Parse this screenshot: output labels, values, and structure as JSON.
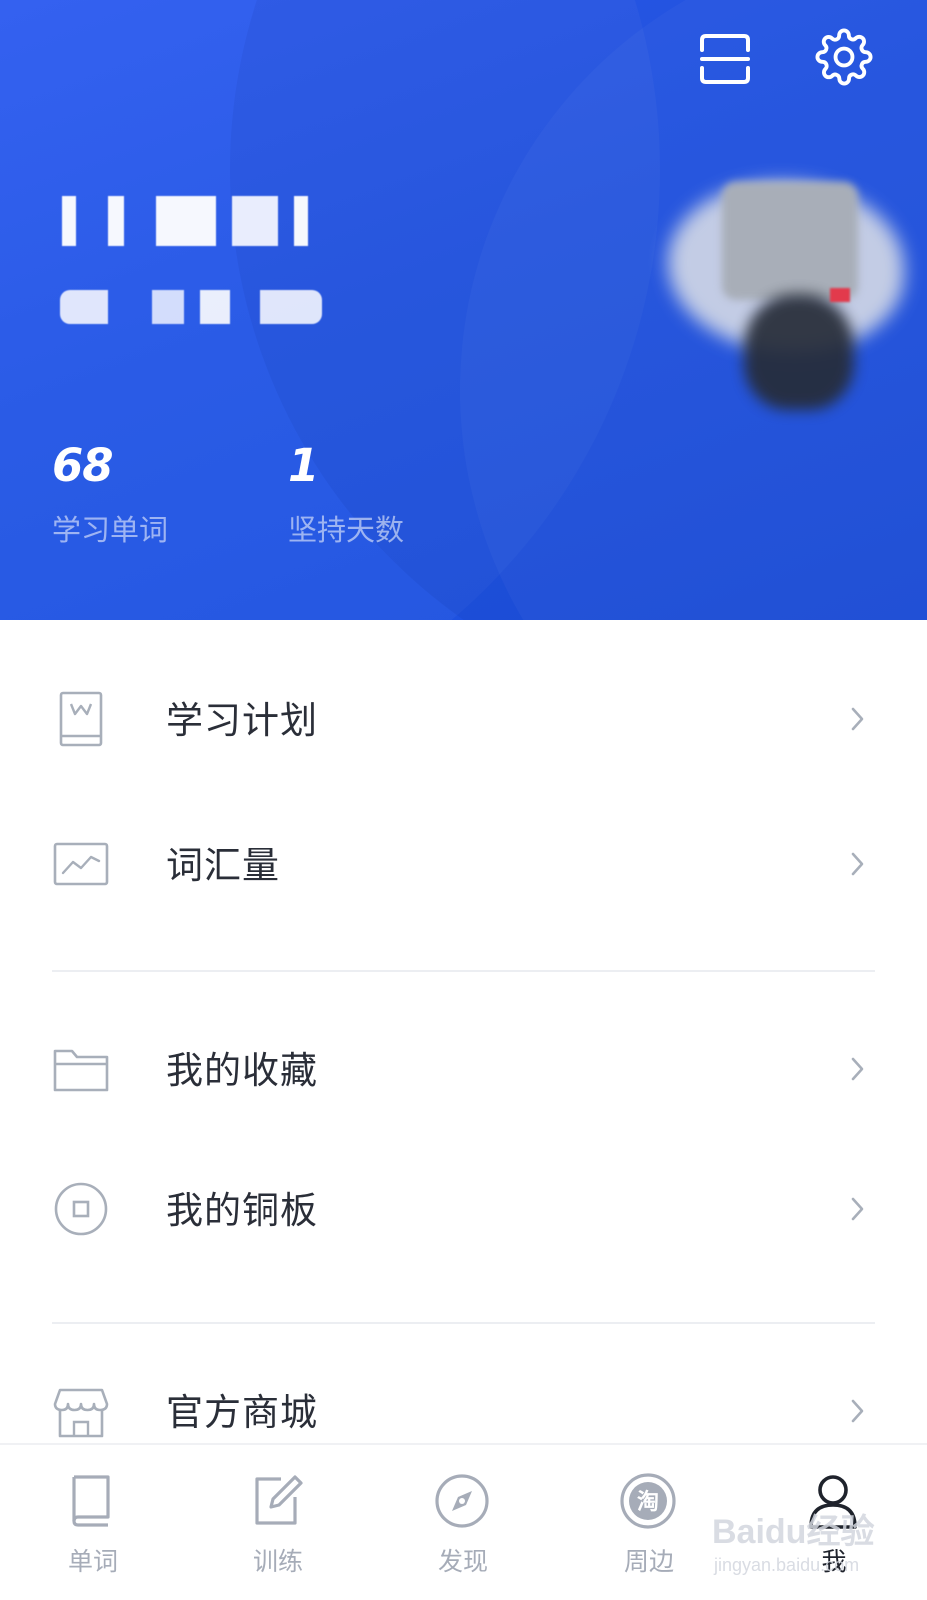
{
  "colors": {
    "header_blue": "#2356e6",
    "text_dark": "#2a2e38",
    "text_muted": "#a6acb8",
    "icon_gray": "#a8afba",
    "divider": "#eceef2",
    "tab_active": "#1f232c"
  },
  "header": {
    "icons": {
      "scan": "scan-icon",
      "settings": "gear-icon"
    },
    "stats": [
      {
        "value": "68",
        "label": "学习单词"
      },
      {
        "value": "1",
        "label": "坚持天数"
      }
    ]
  },
  "menu": {
    "items": [
      {
        "label": "学习计划",
        "icon": "study-plan-icon"
      },
      {
        "label": "词汇量",
        "icon": "vocabulary-chart-icon"
      },
      {
        "label": "我的收藏",
        "icon": "folder-icon"
      },
      {
        "label": "我的铜板",
        "icon": "coin-icon"
      },
      {
        "label": "官方商城",
        "icon": "store-icon"
      }
    ]
  },
  "tabbar": {
    "active": "我",
    "tabs": [
      {
        "label": "单词",
        "icon": "book-icon"
      },
      {
        "label": "训练",
        "icon": "edit-icon"
      },
      {
        "label": "发现",
        "icon": "compass-icon"
      },
      {
        "label": "周边",
        "icon": "taobao-icon"
      },
      {
        "label": "我",
        "icon": "person-icon"
      }
    ]
  },
  "watermark": {
    "logo": "Baidu经验",
    "sub": "jingyan.baidu.com"
  }
}
